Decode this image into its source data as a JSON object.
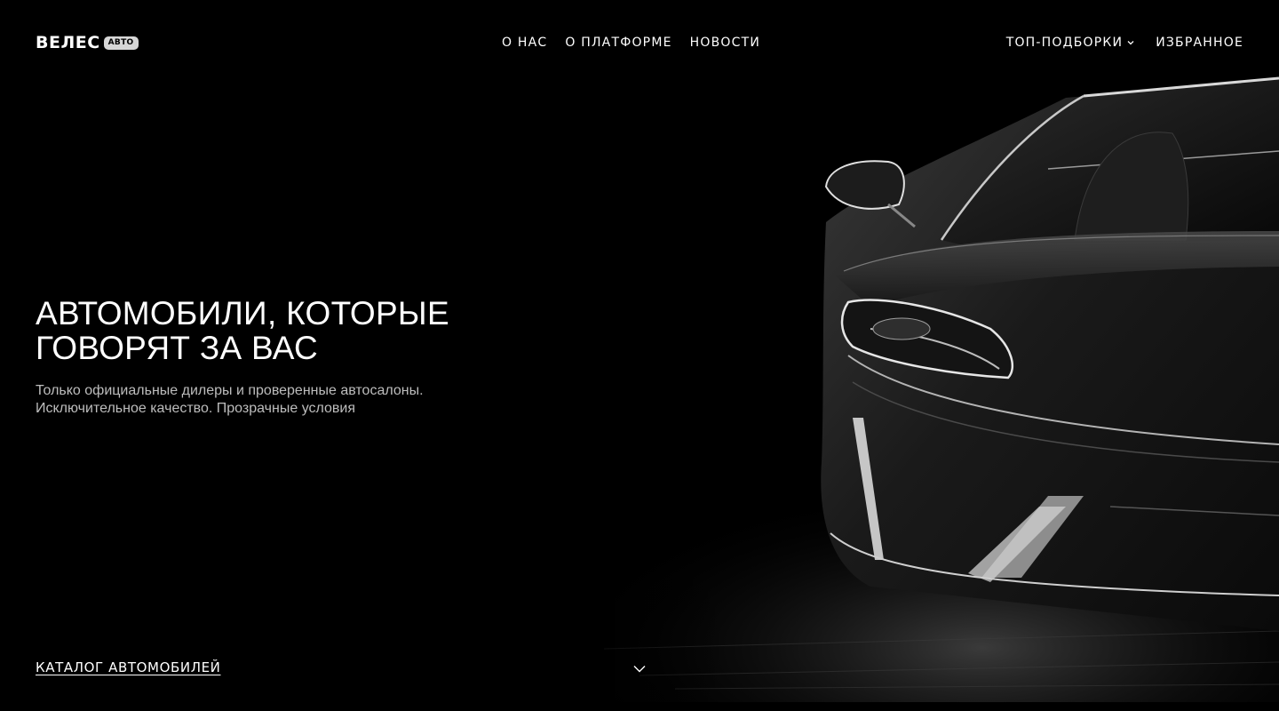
{
  "header": {
    "logo": {
      "word": "ВЕЛЕС",
      "badge": "АВТО"
    },
    "nav_center": [
      {
        "label": "О НАС"
      },
      {
        "label": "О ПЛАТФОРМЕ"
      },
      {
        "label": "НОВОСТИ"
      }
    ],
    "nav_right": {
      "dropdown_label": "ТОП-ПОДБОРКИ",
      "favorites_label": "ИЗБРАННОЕ"
    }
  },
  "hero": {
    "title_line1": "АВТОМОБИЛИ, КОТОРЫЕ",
    "title_line2": "ГОВОРЯТ ЗА ВАС",
    "subtitle_line1": "Только официальные дилеры и проверенные автосалоны.",
    "subtitle_line2": "Исключительное качество. Прозрачные условия",
    "image": "black-sports-car-front-view"
  },
  "bottom": {
    "catalog_label": "КАТАЛОГ АВТОМОБИЛЕЙ",
    "scroll_icon": "chevron-down-icon"
  },
  "colors": {
    "background": "#000000",
    "text": "#ffffff",
    "subtitle": "#bdbdbd",
    "badge_bg": "#d6d6d6"
  }
}
